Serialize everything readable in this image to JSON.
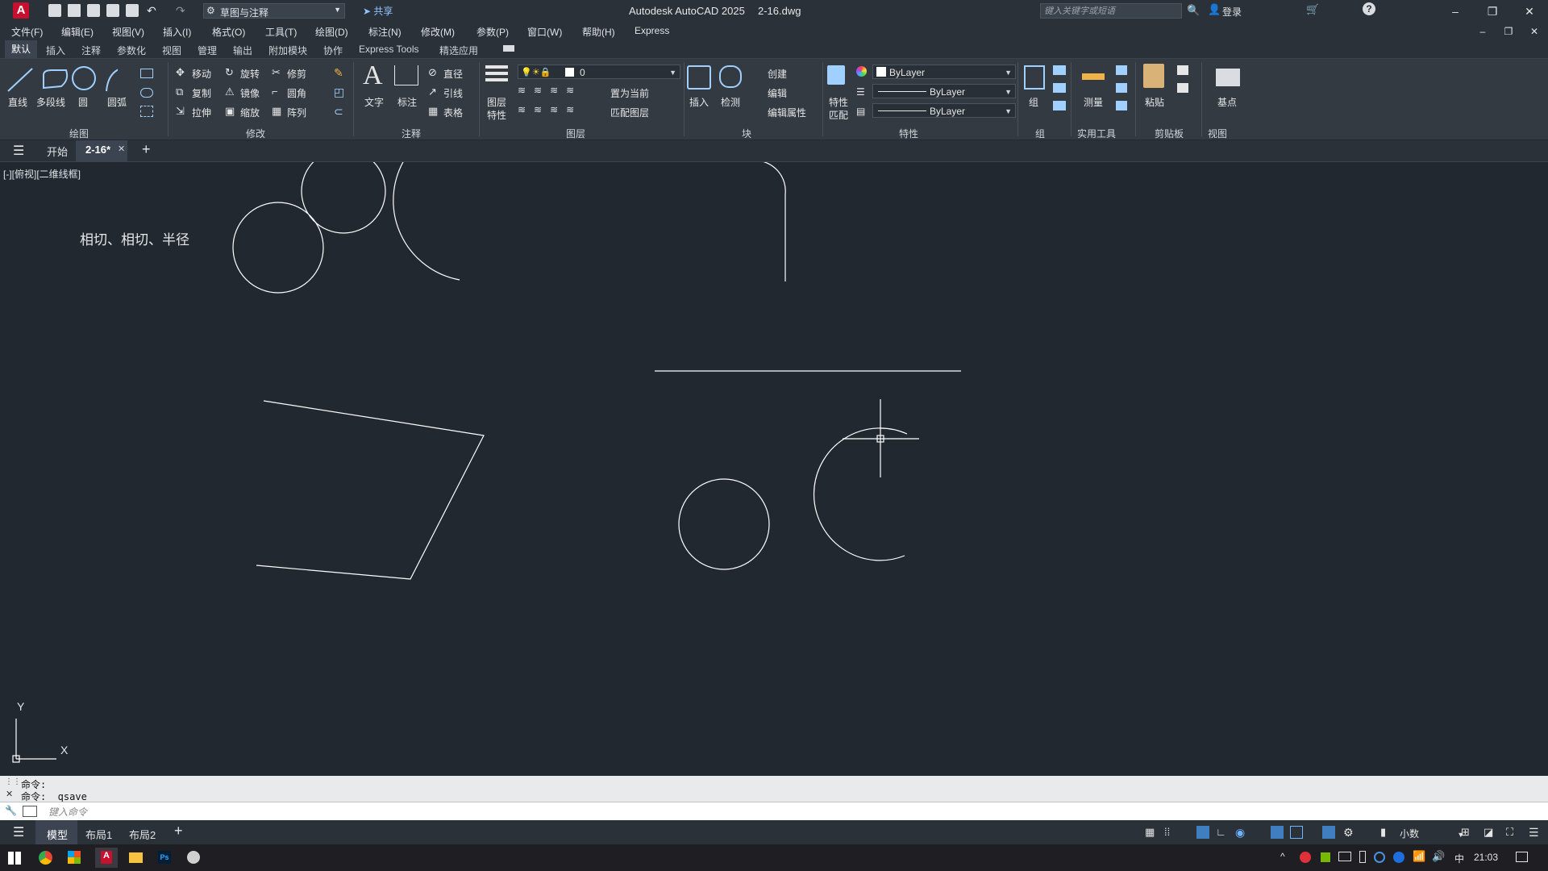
{
  "titlebar": {
    "workspace": "草图与注释",
    "share": "共享",
    "app_title": "Autodesk AutoCAD 2025",
    "doc_title": "2-16.dwg",
    "search_placeholder": "键入关键字或短语",
    "login": "登录"
  },
  "menu": [
    "文件(F)",
    "编辑(E)",
    "视图(V)",
    "插入(I)",
    "格式(O)",
    "工具(T)",
    "绘图(D)",
    "标注(N)",
    "修改(M)",
    "参数(P)",
    "窗口(W)",
    "帮助(H)",
    "Express"
  ],
  "ribbon_tabs": [
    "默认",
    "插入",
    "注释",
    "参数化",
    "视图",
    "管理",
    "输出",
    "附加模块",
    "协作",
    "Express Tools",
    "精选应用"
  ],
  "ribbon": {
    "draw": {
      "line": "直线",
      "polyline": "多段线",
      "circle": "圆",
      "arc": "圆弧",
      "panel": "绘图"
    },
    "modify": {
      "move": "移动",
      "rotate": "旋转",
      "trim": "修剪",
      "copy": "复制",
      "mirror": "镜像",
      "fillet": "圆角",
      "stretch": "拉伸",
      "scale": "缩放",
      "array": "阵列",
      "panel": "修改"
    },
    "annotation": {
      "text": "文字",
      "dimension": "标注",
      "diameter": "直径",
      "leader": "引线",
      "table": "表格",
      "panel": "注释"
    },
    "layers": {
      "layer_props_1": "图层",
      "layer_props_2": "特性",
      "current_layer": "0",
      "set_current": "置为当前",
      "match_layer": "匹配图层",
      "panel": "图层"
    },
    "block": {
      "insert": "插入",
      "detect": "检测",
      "create": "创建",
      "edit": "编辑",
      "edit_attr": "编辑属性",
      "panel": "块"
    },
    "properties": {
      "match_1": "特性",
      "match_2": "匹配",
      "color": "ByLayer",
      "linetype": "ByLayer",
      "lineweight": "ByLayer",
      "panel": "特性"
    },
    "groups": {
      "group": "组",
      "panel": "组"
    },
    "utilities": {
      "measure": "测量",
      "panel": "实用工具"
    },
    "clipboard": {
      "paste": "粘贴",
      "panel": "剪贴板"
    },
    "view": {
      "base": "基点",
      "panel": "视图"
    }
  },
  "filetabs": {
    "start": "开始",
    "current": "2-16*"
  },
  "viewport_label": "[-][俯视][二维线框]",
  "drawing": {
    "annotation_text": "相切、相切、半径",
    "ucs_y": "Y",
    "ucs_x": "X"
  },
  "command": {
    "history": [
      "命令:",
      "命令: _qsave"
    ],
    "placeholder": "键入命令"
  },
  "layout_tabs": [
    "模型",
    "布局1",
    "布局2"
  ],
  "statusbar": {
    "units": "小数"
  },
  "taskbar": {
    "ime": "中",
    "time": "21:03"
  }
}
